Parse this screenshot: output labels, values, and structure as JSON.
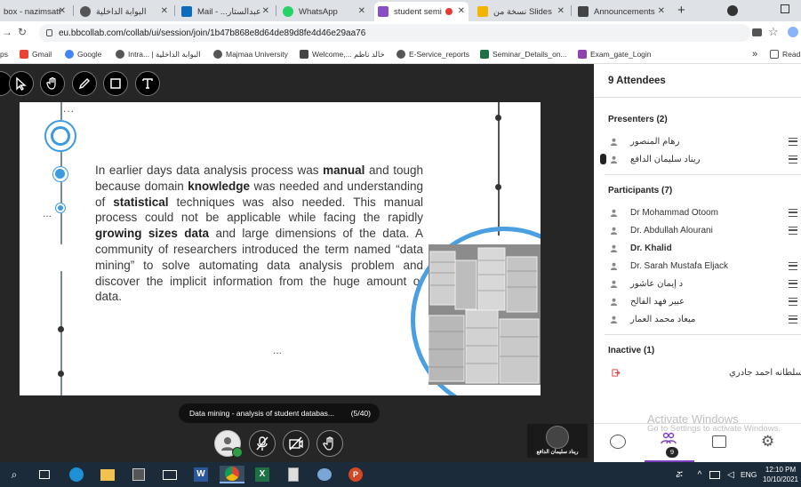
{
  "browser": {
    "tabs": [
      {
        "label": "box - nazimsatt",
        "active": false
      },
      {
        "label": "البوابة الداخلية",
        "active": false
      },
      {
        "label": "Mail - ...عبدالستار",
        "active": false
      },
      {
        "label": "WhatsApp",
        "active": false
      },
      {
        "label": "student semi",
        "active": true
      },
      {
        "label": "نسخة من Slides",
        "active": false
      },
      {
        "label": "Announcements",
        "active": false
      }
    ],
    "new_tab": "+",
    "url": "eu.bbcollab.com/collab/ui/session/join/1b47b868e8d64de89d8fe4d46e29aa76",
    "bookmarks": [
      {
        "label": "ps"
      },
      {
        "label": "Gmail"
      },
      {
        "label": "Google"
      },
      {
        "label": "Intra... | البوابة الداخلية"
      },
      {
        "label": "Majmaa University"
      },
      {
        "label": "Welcome,... خالد ناظم"
      },
      {
        "label": "E-Service_reports"
      },
      {
        "label": "Seminar_Details_on..."
      },
      {
        "label": "Exam_gate_Login"
      }
    ],
    "reading_list": "Read"
  },
  "slide": {
    "top_dots": "...",
    "side_dots": "...",
    "bottom_dots": "...",
    "paragraph": [
      {
        "t": "In earlier days data analysis process was ",
        "b": false
      },
      {
        "t": "manual",
        "b": true
      },
      {
        "t": " and tough because domain ",
        "b": false
      },
      {
        "t": "knowledge",
        "b": true
      },
      {
        "t": " was needed and understanding of ",
        "b": false
      },
      {
        "t": "statistical",
        "b": true
      },
      {
        "t": " techniques was also needed. This manual process could not be applicable while facing the rapidly ",
        "b": false
      },
      {
        "t": "growing sizes data",
        "b": true
      },
      {
        "t": " and large dimensions of the data. A community of researchers introduced the term named “data mining” to solve automating data analysis problem and discover the implicit information from the huge amount of data.",
        "b": false
      }
    ]
  },
  "presentation_bar": {
    "title": "Data mining - analysis of student databas...",
    "page": "(5/40)"
  },
  "self_video": {
    "name": "ريناد سليمان الدافع"
  },
  "panel": {
    "attendees_title": "9 Attendees",
    "presenters_title": "Presenters (2)",
    "presenters": [
      {
        "name": "رهام المنصور"
      },
      {
        "name": "ريناد سليمان الدافع"
      }
    ],
    "participants_title": "Participants (7)",
    "participants": [
      {
        "name": "Dr Mohammad Otoom"
      },
      {
        "name": "Dr. Abdullah Alourani"
      },
      {
        "name": "Dr. Khalid"
      },
      {
        "name": "Dr. Sarah Mustafa Eljack"
      },
      {
        "name": "د إيمان عاشور"
      },
      {
        "name": "عبير فهد الفالح"
      },
      {
        "name": "ميعاد محمد العمار"
      }
    ],
    "inactive_title": "Inactive (1)",
    "inactive": [
      {
        "name": "سلطانه احمد جادري"
      }
    ],
    "attendee_badge": "9",
    "watermark_title": "Activate Windows",
    "watermark_sub": "Go to Settings to activate Windows."
  },
  "taskbar": {
    "time": "12:10 PM",
    "date": "10/10/2021",
    "lang": "ENG"
  }
}
